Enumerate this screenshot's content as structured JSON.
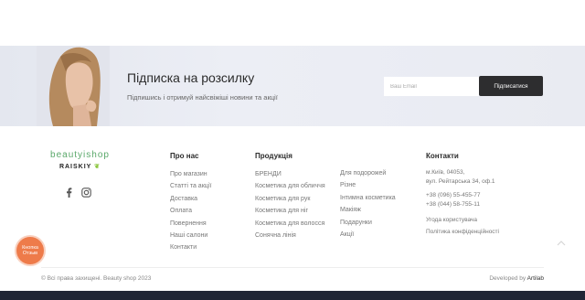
{
  "newsletter": {
    "title": "Підписка на розсилку",
    "subtitle": "Підпишись і отримуй найсвіжіші новини та акції",
    "email_placeholder": "Ваш Email",
    "subscribe_label": "Підписатися"
  },
  "brand": {
    "logo_top": "beautyishop",
    "logo_bottom": "RAISKIY"
  },
  "social": [
    "facebook-icon",
    "instagram-icon"
  ],
  "about": {
    "title": "Про нас",
    "items": [
      "Про магазин",
      "Статті та акції",
      "Доставка",
      "Оплата",
      "Повернення",
      "Наші салони",
      "Контакти"
    ]
  },
  "products": {
    "title": "Продукція",
    "items_left": [
      "БРЕНДИ",
      "Косметика для обличчя",
      "Косметика для рук",
      "Косметика для ніг",
      "Косметика для волосся",
      "Сонячна лінія"
    ],
    "items_right": [
      "Для подорожей",
      "Різне",
      "Інтимна косметика",
      "Макіяж",
      "Подарунки",
      "Акції"
    ]
  },
  "contacts": {
    "title": "Контакти",
    "address_line1": "м.Київ, 04053,",
    "address_line2": "вул. Рейтарська 34, оф.1",
    "phone1": "+38 (096) 55-455-77",
    "phone2": "+38 (044) 58-755-11",
    "link1": "Угода користувача",
    "link2": "Політика конфіденційності"
  },
  "reviews_button": {
    "line1": "Кнопка",
    "line2": "Отзыв"
  },
  "footer": {
    "copyright": "© Всі права захищені. Beauty shop 2023",
    "developed_prefix": "Developed by",
    "developed_name": "Artilab"
  },
  "colors": {
    "accent_green": "#5aa86a",
    "reviews_orange": "#ee7b4a",
    "dark_button": "#2d2d2f",
    "bottom_bar": "#202535"
  }
}
